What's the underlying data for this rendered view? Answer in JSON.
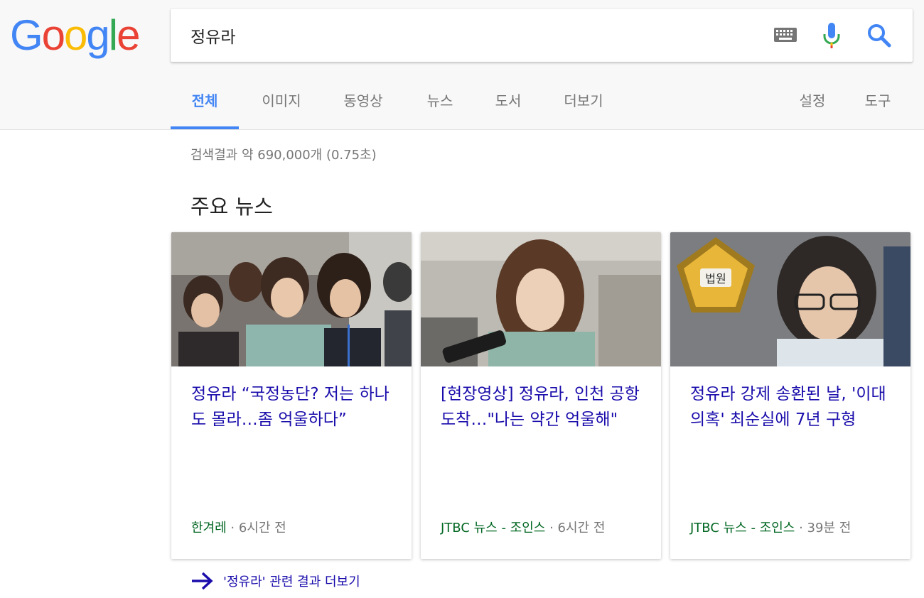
{
  "logo": {
    "letters": [
      "G",
      "o",
      "o",
      "g",
      "l",
      "e"
    ],
    "colors": [
      "#4285f4",
      "#ea4335",
      "#fbbc05",
      "#4285f4",
      "#34a853",
      "#ea4335"
    ]
  },
  "search": {
    "value": "정유라",
    "icons": [
      "keyboard-icon",
      "microphone-icon",
      "search-icon"
    ]
  },
  "tabs": [
    {
      "label": "전체",
      "active": true
    },
    {
      "label": "이미지"
    },
    {
      "label": "동영상"
    },
    {
      "label": "뉴스"
    },
    {
      "label": "도서"
    },
    {
      "label": "더보기"
    }
  ],
  "tools": [
    {
      "label": "설정"
    },
    {
      "label": "도구"
    }
  ],
  "result_stats": "검색결과 약 690,000개 (0.75초)",
  "top_news": {
    "title": "주요 뉴스",
    "cards": [
      {
        "title": "정유라 “국정농단? 저는 하나도 몰라…좀 억울하다”",
        "source": "한겨레",
        "separator": " · ",
        "time": "6시간 전"
      },
      {
        "title": "[현장영상] 정유라, 인천 공항 도착…\"나는 약간 억울해\"",
        "source": "JTBC 뉴스 - 조인스",
        "separator": " · ",
        "time": "6시간 전"
      },
      {
        "title": "정유라 강제 송환된 날, '이대 의혹' 최순실에 7년 구형",
        "source": "JTBC 뉴스 - 조인스",
        "separator": " · ",
        "time": "39분 전",
        "image_badge": "법원"
      }
    ],
    "more_link": "'정유라' 관련 결과 더보기"
  },
  "colors": {
    "accent": "#4285f4",
    "link": "#1a0dab",
    "source": "#006621",
    "muted": "#777777"
  }
}
